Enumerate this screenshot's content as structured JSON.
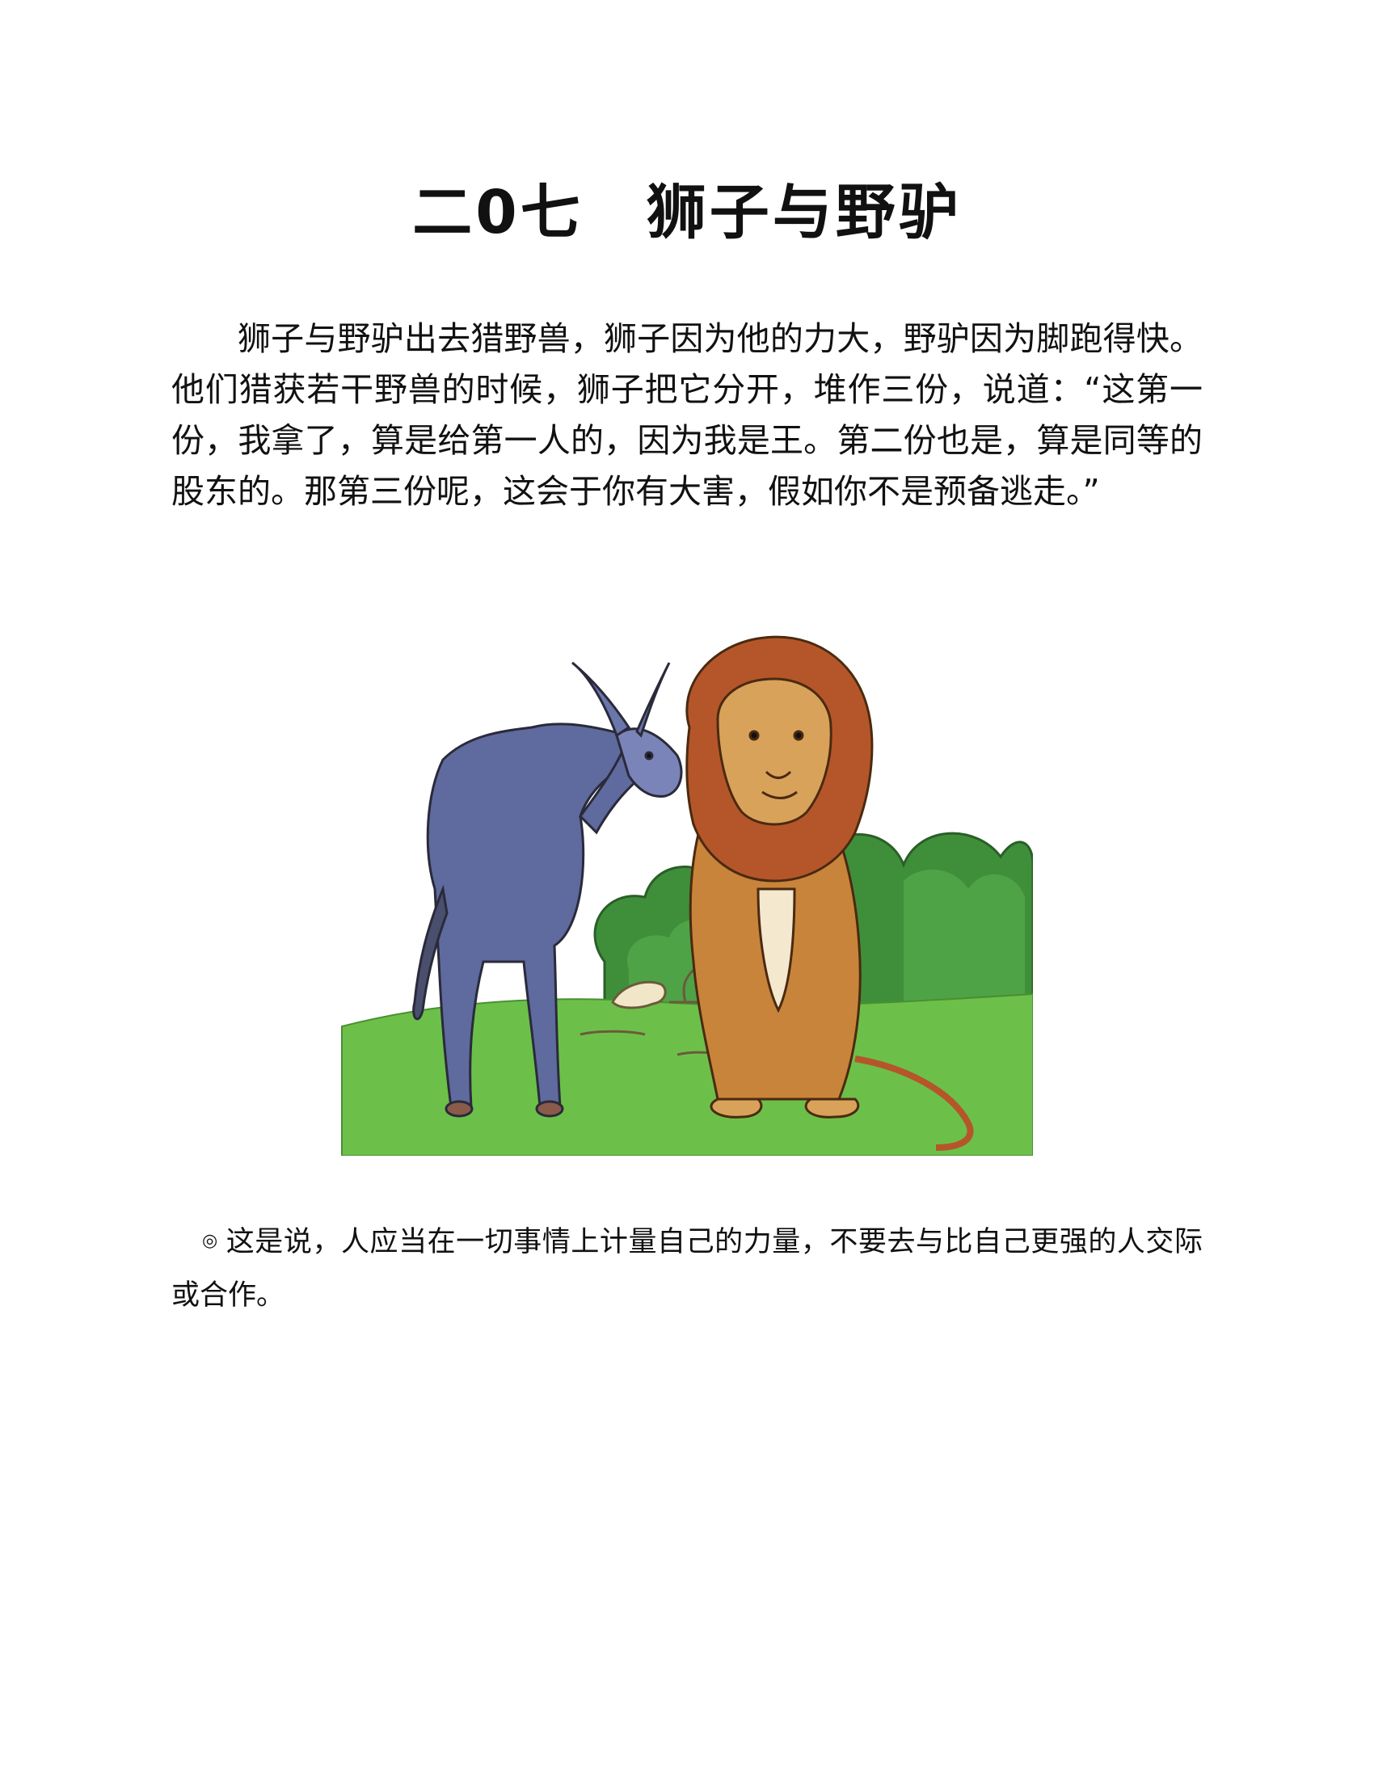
{
  "title": "二0七　狮子与野驴",
  "story": "狮子与野驴出去猎野兽，狮子因为他的力大，野驴因为脚跑得快。他们猎获若干野兽的时候，狮子把它分开，堆作三份，说道：“这第一份，我拿了，算是给第一人的，因为我是王。第二份也是，算是同等的股东的。那第三份呢，这会于你有大害，假如你不是预备逃走。”",
  "illustration": {
    "subject": "donkey and lion illustration",
    "colors": {
      "grass": "#6cc04a",
      "bush": "#3f8f3a",
      "donkey": "#5f6a9e",
      "lion": "#c8843a",
      "mane": "#b5562a"
    }
  },
  "moral": {
    "mark": "◎",
    "text": "这是说，人应当在一切事情上计量自己的力量，不要去与比自己更强的人交际或合作。"
  }
}
